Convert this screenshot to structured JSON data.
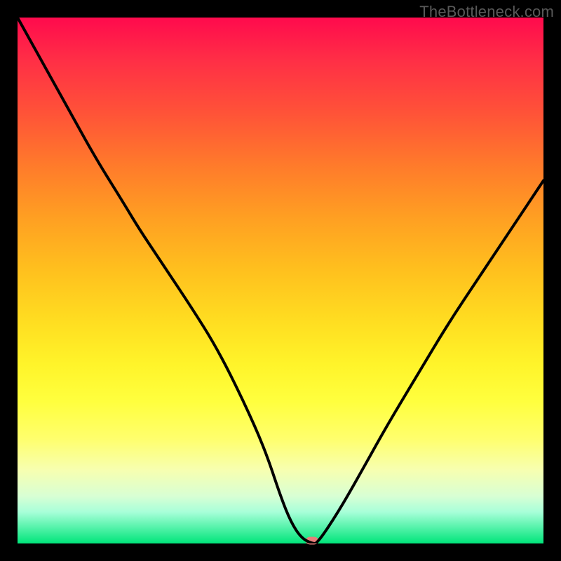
{
  "watermark": "TheBottleneck.com",
  "colors": {
    "frame": "#000000",
    "marker": "#e77e7a",
    "curve_stroke": "#000000",
    "watermark_text": "#595959"
  },
  "chart_data": {
    "type": "line",
    "title": "",
    "xlabel": "",
    "ylabel": "",
    "xlim": [
      0,
      100
    ],
    "ylim": [
      0,
      100
    ],
    "grid": false,
    "series": [
      {
        "name": "bottleneck-curve",
        "x": [
          0,
          5,
          10,
          15,
          20,
          23,
          27,
          33,
          38,
          43,
          47,
          50,
          52,
          54,
          56,
          57,
          61,
          65,
          70,
          76,
          82,
          88,
          94,
          100
        ],
        "values": [
          100,
          91,
          82,
          73,
          65,
          60,
          54,
          45,
          37,
          27,
          18,
          9,
          4,
          1,
          0,
          0,
          6,
          13,
          22,
          32,
          42,
          51,
          60,
          69
        ]
      }
    ],
    "marker": {
      "x": 56,
      "y": 0
    },
    "gradient_stops": [
      {
        "pos": 0.0,
        "color": "#ff0a4d"
      },
      {
        "pos": 0.18,
        "color": "#ff5238"
      },
      {
        "pos": 0.38,
        "color": "#ff9f22"
      },
      {
        "pos": 0.58,
        "color": "#ffde21"
      },
      {
        "pos": 0.8,
        "color": "#ffff6c"
      },
      {
        "pos": 0.91,
        "color": "#d8ffd4"
      },
      {
        "pos": 1.0,
        "color": "#00e57a"
      }
    ]
  }
}
